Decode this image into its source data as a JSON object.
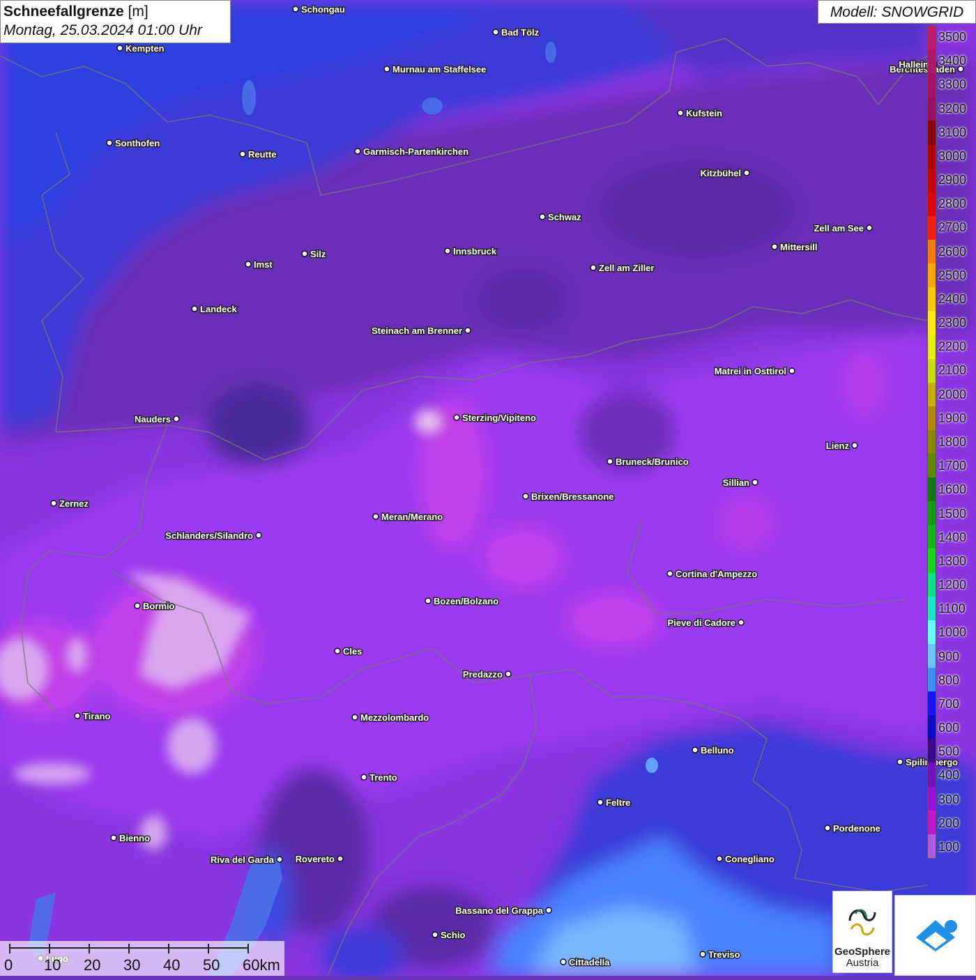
{
  "header": {
    "title_bold": "Schneefallgrenze",
    "title_unit": "[m]",
    "datetime": "Montag, 25.03.2024 01:00 Uhr",
    "model": "Modell: SNOWGRID"
  },
  "legend": {
    "labels": [
      "3500",
      "3400",
      "3300",
      "3200",
      "3100",
      "3000",
      "2900",
      "2800",
      "2700",
      "2600",
      "2500",
      "2400",
      "2300",
      "2200",
      "2100",
      "2000",
      "1900",
      "1800",
      "1700",
      "1600",
      "1500",
      "1400",
      "1300",
      "1200",
      "1100",
      "1000",
      "900",
      "800",
      "700",
      "600",
      "500",
      "400",
      "300",
      "200",
      "100"
    ],
    "colors": [
      "#c2186e",
      "#b3156a",
      "#a81263",
      "#9d0f5c",
      "#8b0000",
      "#b00000",
      "#cc0000",
      "#e50000",
      "#ff1a00",
      "#ff7a00",
      "#ffa500",
      "#ffc800",
      "#ffee00",
      "#e8f200",
      "#c8e000",
      "#c8b000",
      "#b08a00",
      "#8a8a00",
      "#5f8a00",
      "#107a10",
      "#119c11",
      "#12b812",
      "#15d415",
      "#00e680",
      "#14e8c0",
      "#66ffff",
      "#66c8ff",
      "#3b8fff",
      "#1414ff",
      "#0a0ac8",
      "#3a0a8a",
      "#7410c0",
      "#9a10d8",
      "#c814c8",
      "#b05ae0"
    ]
  },
  "cities": [
    {
      "name": "Schongau"
    },
    {
      "name": "Bad Tölz"
    },
    {
      "name": "Kempten"
    },
    {
      "name": "Murnau am Staffelsee"
    },
    {
      "name": "Berchtesgaden"
    },
    {
      "name": "Kufstein"
    },
    {
      "name": "Sonthofen"
    },
    {
      "name": "Reutte"
    },
    {
      "name": "Garmisch-Partenkirchen"
    },
    {
      "name": "Kitzbühel"
    },
    {
      "name": "Schwaz"
    },
    {
      "name": "Zell am See"
    },
    {
      "name": "Mittersill"
    },
    {
      "name": "Innsbruck"
    },
    {
      "name": "Imst"
    },
    {
      "name": "Silz"
    },
    {
      "name": "Zell am Ziller"
    },
    {
      "name": "Landeck"
    },
    {
      "name": "Steinach am Brenner"
    },
    {
      "name": "Matrei in Osttirol"
    },
    {
      "name": "Nauders"
    },
    {
      "name": "Sterzing/Vipiteno"
    },
    {
      "name": "Lienz"
    },
    {
      "name": "Bruneck/Brunico"
    },
    {
      "name": "Sillian"
    },
    {
      "name": "Zernez"
    },
    {
      "name": "Brixen/Bressanone"
    },
    {
      "name": "Meran/Merano"
    },
    {
      "name": "Schlanders/Silandro"
    },
    {
      "name": "Cortina d'Ampezzo"
    },
    {
      "name": "Bozen/Bolzano"
    },
    {
      "name": "Bormio"
    },
    {
      "name": "Pieve di Cadore"
    },
    {
      "name": "Cles"
    },
    {
      "name": "Predazzo"
    },
    {
      "name": "Tirano"
    },
    {
      "name": "Mezzolombardo"
    },
    {
      "name": "Belluno"
    },
    {
      "name": "Spilimbergo"
    },
    {
      "name": "Trento"
    },
    {
      "name": "Feltre"
    },
    {
      "name": "Pordenone"
    },
    {
      "name": "Bienno"
    },
    {
      "name": "Riva del Garda"
    },
    {
      "name": "Rovereto"
    },
    {
      "name": "Conegliano"
    },
    {
      "name": "Bassano del Grappa"
    },
    {
      "name": "Schio"
    },
    {
      "name": "Treviso"
    },
    {
      "name": "Cittadella"
    },
    {
      "name": "Lugo"
    },
    {
      "name": "Hallein"
    }
  ],
  "scale": {
    "labels": [
      "0",
      "10",
      "20",
      "30",
      "40",
      "50",
      "60km"
    ]
  },
  "logo": {
    "name": "GeoSphere",
    "sub": "Austria"
  }
}
